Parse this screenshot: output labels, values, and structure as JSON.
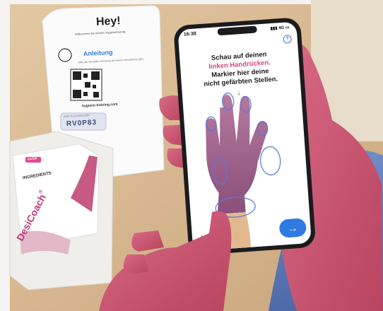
{
  "card": {
    "greeting": "Hey!",
    "welcome": "Willkommen bei deinem Hygienetraining.",
    "guide_title": "Anleitung",
    "guide_text": "Öffne die interaktive Anleitung auf deinem Smartphone (DE)",
    "url": "hygiene-training.com",
    "code_label": "DEIN ZUGANGSCODE",
    "code": "RV0P83"
  },
  "pack": {
    "tag": "Farbe",
    "ingredients_title": "INGREDIENTS",
    "brand": "DesiCoach",
    "reg": "®"
  },
  "phone": {
    "time": "16:38",
    "network": "4G",
    "help_icon": "question-icon",
    "instruction_line1": "Schau auf deinen",
    "instruction_line2": "linken Handrücken.",
    "instruction_line3": "Markier hier deine",
    "instruction_line4": "nicht gefärbten Stellen.",
    "down_arrow": "↓",
    "back_arrow": "←",
    "next_arrow": "→"
  },
  "colors": {
    "accent_blue": "#2f7ae0",
    "accent_pink": "#e0408a"
  }
}
